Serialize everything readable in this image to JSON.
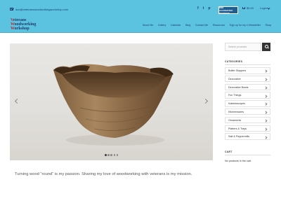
{
  "topbar": {
    "email": "don@veteranswoodworkingworkshop.com",
    "social": [
      {
        "icon": "facebook-icon",
        "glyph": "f"
      },
      {
        "icon": "twitter-icon",
        "glyph": "t"
      },
      {
        "icon": "pinterest-icon",
        "glyph": "p"
      }
    ],
    "bbb_badge": "BBB ACCREDITED BUSINESS",
    "cart_total": "$0.00",
    "login": "Login"
  },
  "logo": {
    "line1_initial": "V",
    "line1_rest": "eterans",
    "line2_initial": "W",
    "line2_rest": "oodworking",
    "line3_initial": "W",
    "line3_rest": "orkshop"
  },
  "nav": {
    "items": [
      "About Me",
      "Gallery",
      "Calendar",
      "Blog",
      "Contact Me",
      "Resources",
      "Sign up for my e-Newsletter",
      "Shop"
    ]
  },
  "slider": {
    "slide_count": 5,
    "active_index": 0
  },
  "tagline": "Turning wood “round” is my passion. Sharing my love of woodworking with veterans is my mission.",
  "sidebar": {
    "search_placeholder": "Search products",
    "categories_title": "CATEGORIES",
    "categories": [
      "Bottle Stoppers",
      "Decorative",
      "Decorative Bowls",
      "Fun Things",
      "Kaleidoscopes",
      "Kitchenwares",
      "Ornaments",
      "Platters & Trays",
      "Salt & Peppermills"
    ],
    "cart_title": "CART",
    "cart_empty": "No products in the cart."
  },
  "colors": {
    "header_bg": "#5bc2e0",
    "navy": "#1f3b6b",
    "logo_red": "#c0272d"
  }
}
